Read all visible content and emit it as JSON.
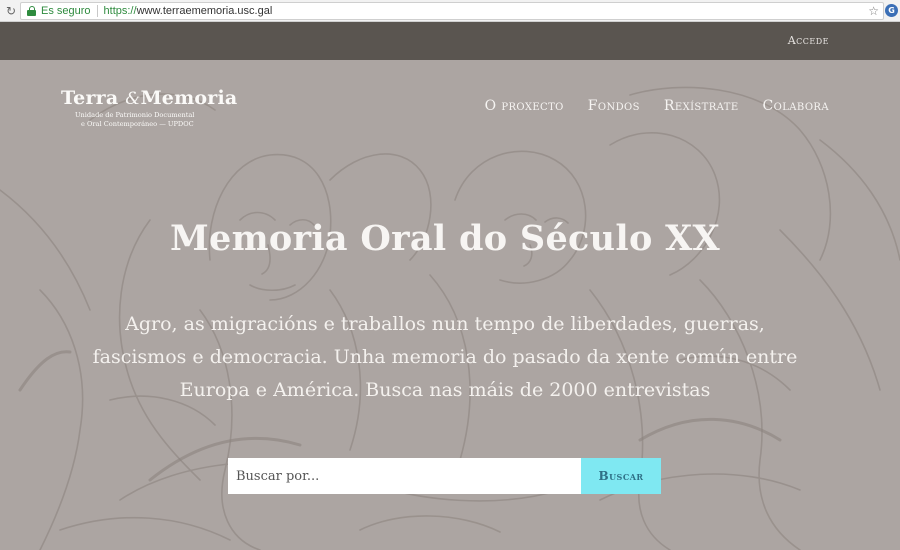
{
  "browser": {
    "secure_label": "Es seguro",
    "url_scheme": "https://",
    "url_host": "www.terraememoria.usc.gal",
    "reload_icon": "reload-icon",
    "star_icon": "star-icon",
    "extension_icon": "extension-icon",
    "extension_glyph": "G"
  },
  "top_bar": {
    "login_label": "Accede"
  },
  "logo": {
    "word1": "Terra",
    "amp": "&",
    "word2": "Memoria",
    "subtitle_line1": "Unidade de Patrimonio Documental",
    "subtitle_line2": "e Oral Contemporáneo — UPDOC"
  },
  "nav": {
    "items": [
      "O proxecto",
      "Fondos",
      "Rexístrate",
      "Colabora"
    ]
  },
  "hero": {
    "title": "Memoria Oral do Século XX",
    "description": "Agro, as migracións e traballos nun tempo de liberdades, guerras, fascismos e democracia. Unha memoria do pasado da xente común entre Europa e América. Busca nas máis de 2000 entrevistas"
  },
  "search": {
    "placeholder": "Buscar por...",
    "value": "",
    "button_label": "Buscar"
  },
  "colors": {
    "top_bar_bg": "#5a5550",
    "hero_bg": "#aca5a2",
    "button_bg": "#7fe8f2",
    "button_text": "#2f6f86",
    "secure_green": "#2e8b3e"
  }
}
